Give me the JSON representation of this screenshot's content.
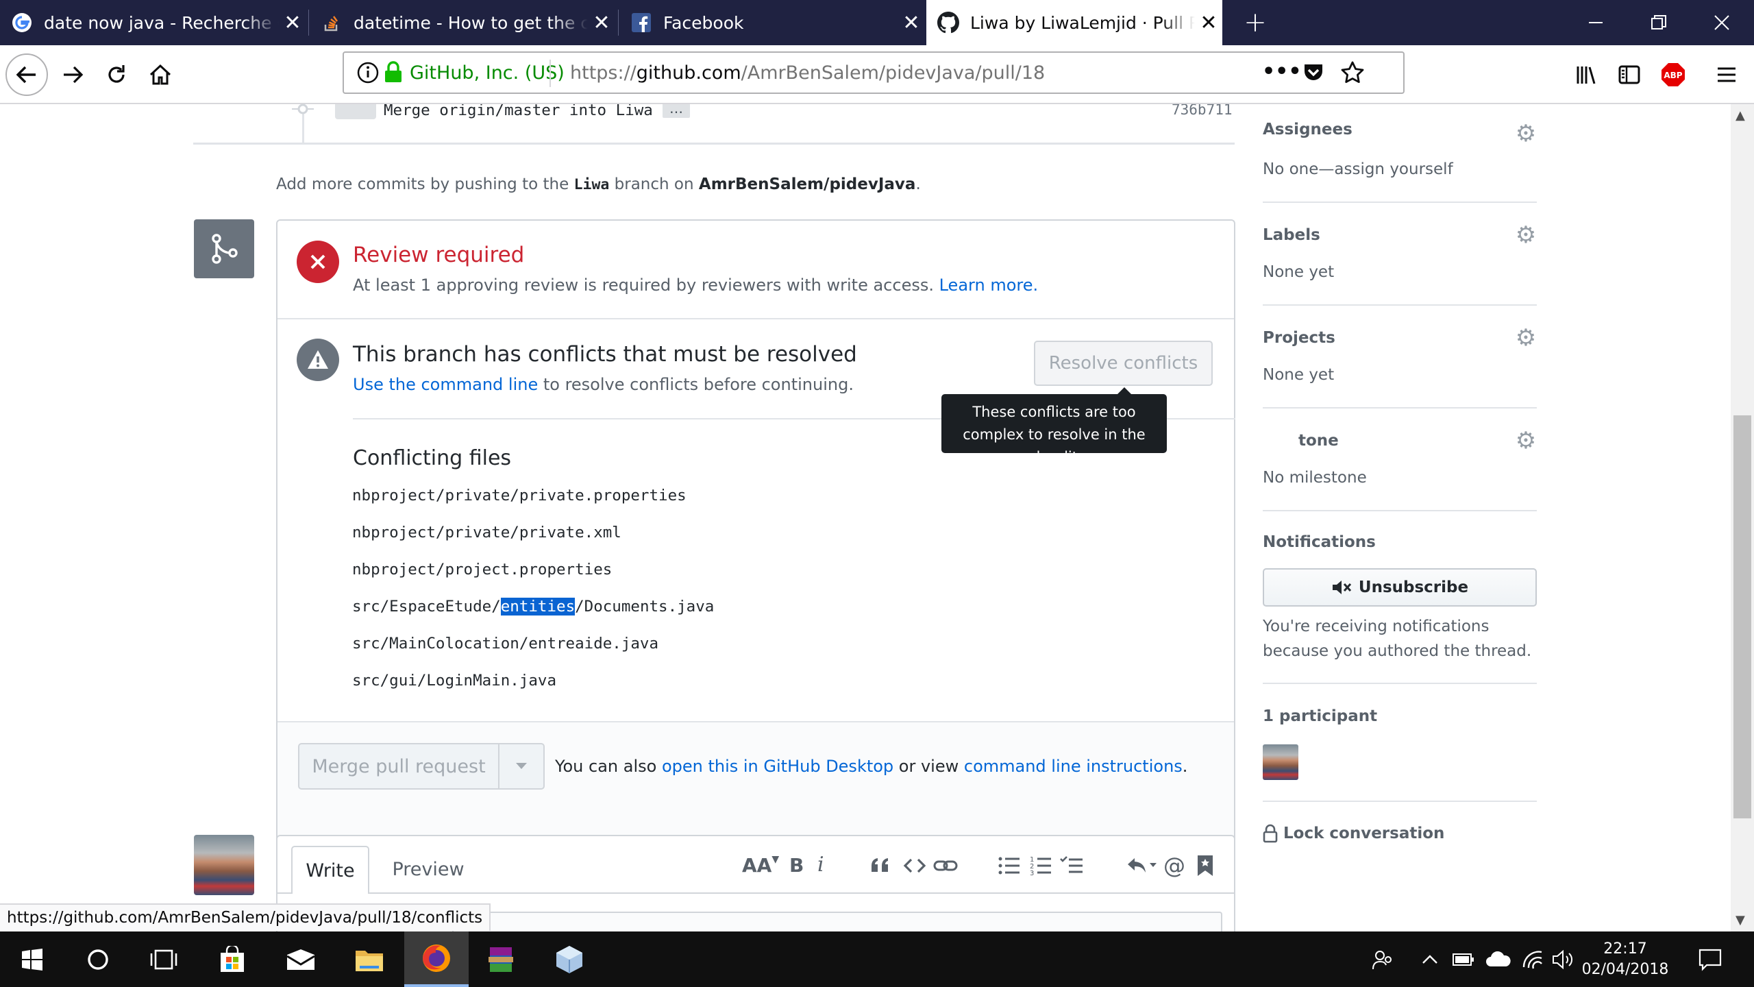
{
  "browser": {
    "tabs": [
      {
        "title": "date now java - Recherche Google",
        "favicon": "google-icon"
      },
      {
        "title": "datetime - How to get the current date",
        "favicon": "stackoverflow-icon"
      },
      {
        "title": "Facebook",
        "favicon": "facebook-icon"
      },
      {
        "title": "Liwa by LiwaLemjid · Pull Request",
        "favicon": "github-icon",
        "active": true
      }
    ],
    "url_identity": "GitHub, Inc. (US)",
    "url_prefix": "https://",
    "url_host": "github.com",
    "url_path": "/AmrBenSalem/pidevJava/pull/18",
    "status_url": "https://github.com/AmrBenSalem/pidevJava/pull/18/conflicts",
    "abp_label": "ABP"
  },
  "timeline": {
    "commit_message": "Merge origin/master into Liwa",
    "commit_ellipsis": "…",
    "commit_sha": "736b711",
    "push_prefix": "Add more commits by pushing to the ",
    "push_branch": "Liwa",
    "push_middle": " branch on ",
    "push_repo": "AmrBenSalem/pidevJava",
    "push_suffix": "."
  },
  "merge_box": {
    "review_title": "Review required",
    "review_text": "At least 1 approving review is required by reviewers with write access. ",
    "learn_more": "Learn more.",
    "conflict_title": "This branch has conflicts that must be resolved",
    "conflict_link": "Use the command line",
    "conflict_text": " to resolve conflicts before continuing.",
    "resolve_button": "Resolve conflicts",
    "tooltip": "These conflicts are too complex to resolve in the web editor",
    "conflicting_files_title": "Conflicting files",
    "files": [
      "nbproject/private/private.properties",
      "nbproject/private/private.xml",
      "nbproject/project.properties",
      "src/EspaceEtude/entities/Documents.java",
      "src/MainColocation/entreaide.java",
      "src/gui/LoginMain.java"
    ],
    "file_highlight": {
      "before": "src/EspaceEtude/",
      "selected": "entities",
      "after": "/Documents.java"
    },
    "merge_button": "Merge pull request",
    "also_prefix": "You can also ",
    "also_link1": "open this in GitHub Desktop",
    "also_middle": " or view ",
    "also_link2": "command line instructions",
    "also_suffix": "."
  },
  "comment": {
    "tab_write": "Write",
    "tab_preview": "Preview",
    "toolbar": {
      "header": "AA",
      "bold": "B",
      "italic": "i"
    }
  },
  "sidebar": {
    "assignees_label": "Assignees",
    "assignees_value": "No one—assign yourself",
    "labels_label": "Labels",
    "labels_value": "None yet",
    "projects_label": "Projects",
    "projects_value": "None yet",
    "milestone_label_visible": "tone",
    "milestone_value": "No milestone",
    "notifications_label": "Notifications",
    "unsubscribe_button": "Unsubscribe",
    "notifications_reason": "You're receiving notifications because you authored the thread.",
    "participants_label": "1 participant",
    "lock_label": "Lock conversation"
  },
  "taskbar": {
    "time": "22:17",
    "date": "02/04/2018"
  },
  "colors": {
    "danger": "#cb2431",
    "link": "#0366d6",
    "titlebar": "#1f2241",
    "selection": "#0a64d2"
  }
}
